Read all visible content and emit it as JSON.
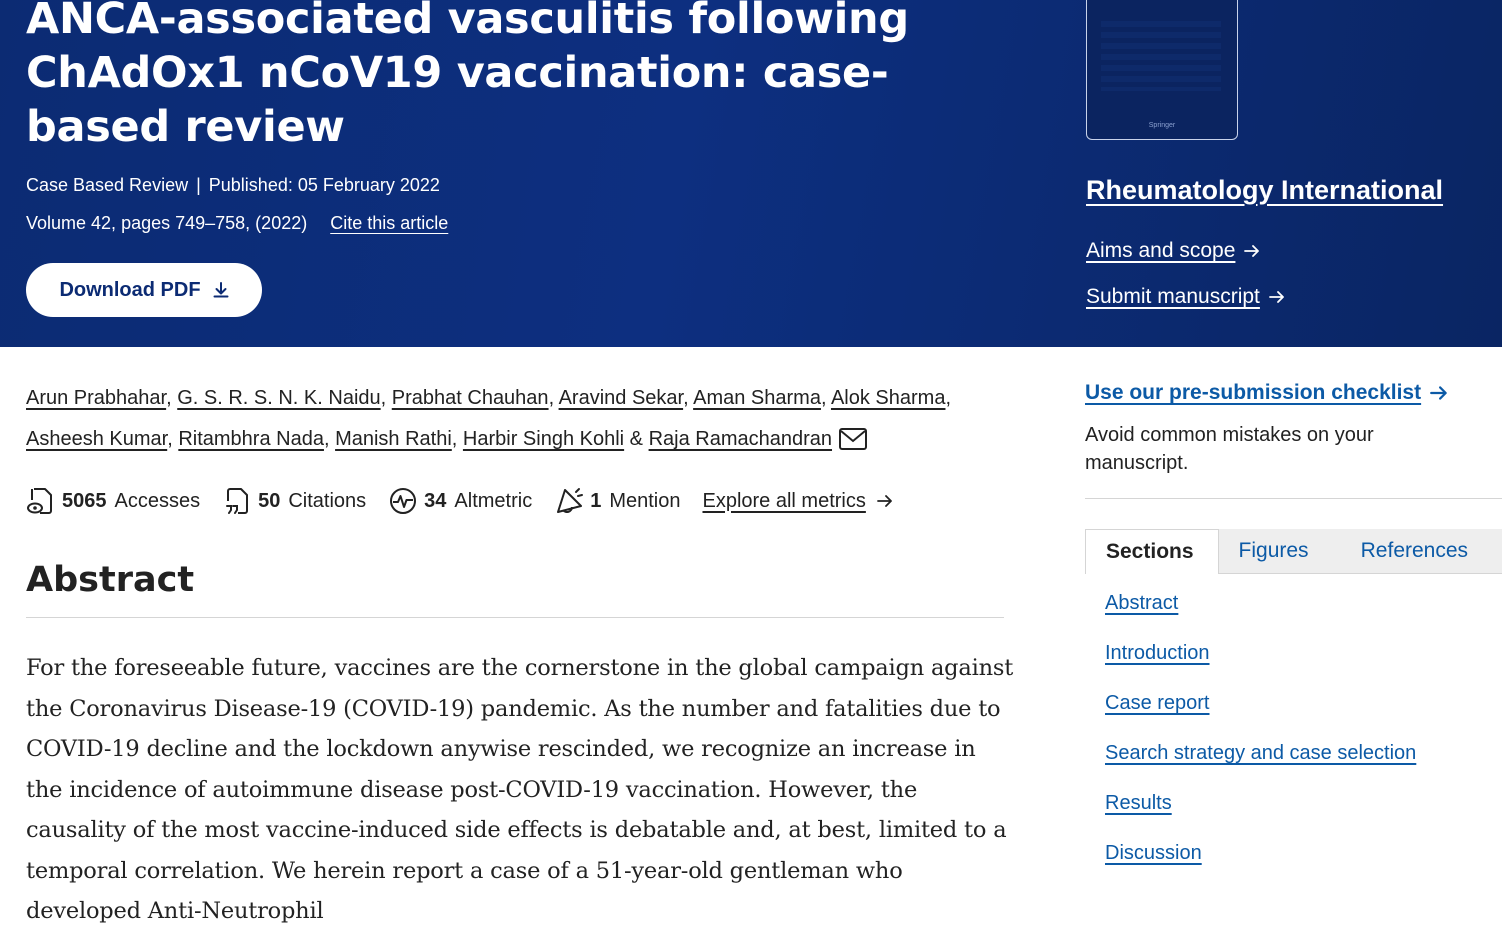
{
  "header": {
    "title": "ANCA-associated vasculitis following ChAdOx1 nCoV19 vaccination: case-based review",
    "article_type": "Case Based Review",
    "published": "Published: 05 February 2022",
    "volume": "Volume 42, pages 749–758, (2022)",
    "cite_label": "Cite this article",
    "download_label": "Download PDF",
    "cover_publisher": "Springer"
  },
  "journal": {
    "name": "Rheumatology International",
    "aims_label": "Aims and scope",
    "submit_label": "Submit manuscript"
  },
  "authors": [
    "Arun Prabhahar",
    "G. S. R. S. N. K. Naidu",
    "Prabhat Chauhan",
    "Aravind Sekar",
    "Aman Sharma",
    "Alok Sharma",
    "Asheesh Kumar",
    "Ritambhra Nada",
    "Manish Rathi",
    "Harbir Singh Kohli",
    "Raja Ramachandran"
  ],
  "author_separator": ", ",
  "author_last_separator": " & ",
  "metrics": {
    "accesses_value": "5065",
    "accesses_label": "Accesses",
    "citations_value": "50",
    "citations_label": "Citations",
    "altmetric_value": "34",
    "altmetric_label": "Altmetric",
    "mentions_value": "1",
    "mentions_label": "Mention",
    "explore_label": "Explore all metrics"
  },
  "abstract": {
    "heading": "Abstract",
    "text": "For the foreseeable future, vaccines are the cornerstone in the global campaign against the Coronavirus Disease-19 (COVID-19) pandemic. As the number and fatalities due to COVID-19 decline and the lockdown anywise rescinded, we recognize an increase in the incidence of autoimmune disease post-COVID-19 vaccination. However, the causality of the most vaccine-induced side effects is debatable and, at best, limited to a temporal correlation. We herein report a case of a 51-year-old gentleman who developed Anti-Neutrophil"
  },
  "sidebar": {
    "checklist_label": "Use our pre-submission checklist",
    "checklist_desc": "Avoid common mistakes on your manuscript.",
    "tabs": [
      "Sections",
      "Figures",
      "References"
    ],
    "sections": [
      "Abstract",
      "Introduction",
      "Case report",
      "Search strategy and case selection",
      "Results",
      "Discussion"
    ]
  },
  "colors": {
    "header_bg": "#0c2b73",
    "link_blue": "#0c5aa6",
    "text": "#222222"
  }
}
